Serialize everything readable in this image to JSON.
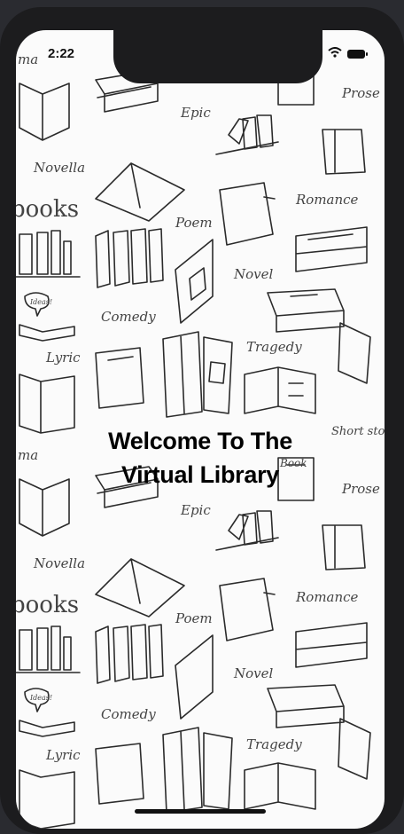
{
  "status_bar": {
    "time": "2:22",
    "wifi_icon": "wifi-icon",
    "battery_icon": "battery-icon"
  },
  "welcome": {
    "line1": "Welcome To The",
    "line2": "Virtual Library"
  },
  "background": {
    "words": [
      "Prose",
      "Epic",
      "Novella",
      "Poem",
      "Romance",
      "Novel",
      "Comedy",
      "Tragedy",
      "Lyric",
      "Short story",
      "Book",
      "books",
      "Ideas!"
    ],
    "top_left_fragment": "ma"
  },
  "colors": {
    "device_frame": "#1c1c1e",
    "screen_bg": "#fbfbfb",
    "text": "#000000"
  }
}
